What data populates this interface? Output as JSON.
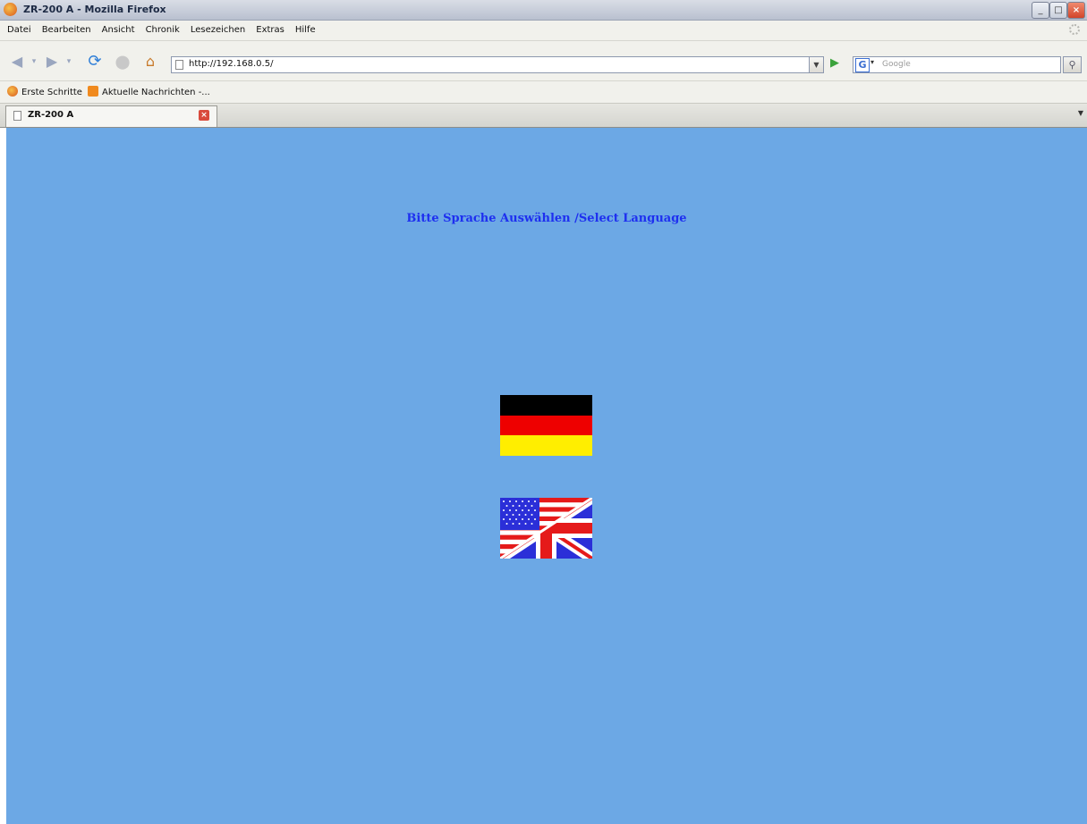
{
  "window": {
    "title": "ZR-200 A - Mozilla Firefox",
    "controls": [
      "_",
      "□",
      "×"
    ]
  },
  "menu": [
    "Datei",
    "Bearbeiten",
    "Ansicht",
    "Chronik",
    "Lesezeichen",
    "Extras",
    "Hilfe"
  ],
  "nav": {
    "url": "http://192.168.0.5/",
    "search_placeholder": "Google",
    "search_engine_letter": "G"
  },
  "bookmarks": [
    {
      "label": "Erste Schritte",
      "icon": "firefox-icon"
    },
    {
      "label": "Aktuelle Nachrichten -...",
      "icon": "rss-feed-icon"
    }
  ],
  "tab": {
    "title": "ZR-200 A"
  },
  "page": {
    "background": "#6ca8e5",
    "heading": "Bitte Sprache Auswählen /Select Language",
    "heading_color": "#1e2ff0",
    "languages": [
      {
        "id": "de",
        "icon": "german-flag-icon",
        "colors": [
          "#000000",
          "#ee0000",
          "#ffee00"
        ]
      },
      {
        "id": "en",
        "icon": "us-uk-flag-icon"
      }
    ]
  }
}
